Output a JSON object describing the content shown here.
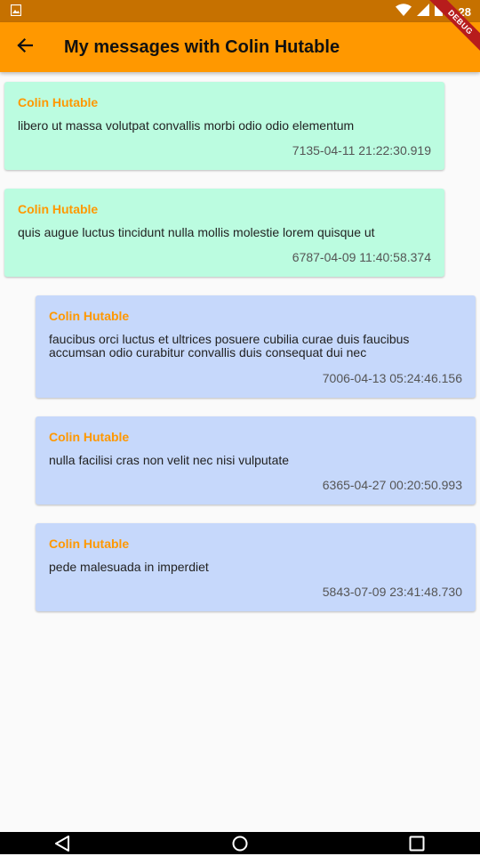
{
  "status_bar": {
    "time": "4:28"
  },
  "app_bar": {
    "title": "My messages with Colin Hutable",
    "debug_label": "DEBUG"
  },
  "messages": [
    {
      "author": "Colin Hutable",
      "text": "libero ut massa volutpat convallis morbi odio odio elementum",
      "timestamp": "7135-04-11 21:22:30.919"
    },
    {
      "author": "Colin Hutable",
      "text": "quis augue luctus tincidunt nulla mollis molestie lorem quisque ut",
      "timestamp": "6787-04-09 11:40:58.374"
    },
    {
      "author": "Colin Hutable",
      "text": "faucibus orci luctus et ultrices posuere cubilia curae duis faucibus accumsan odio curabitur convallis duis consequat dui nec",
      "timestamp": "7006-04-13 05:24:46.156"
    },
    {
      "author": "Colin Hutable",
      "text": "nulla facilisi cras non velit nec nisi vulputate",
      "timestamp": "6365-04-27 00:20:50.993"
    },
    {
      "author": "Colin Hutable",
      "text": "pede malesuada in imperdiet",
      "timestamp": "5843-07-09 23:41:48.730"
    }
  ],
  "colors": {
    "app_bar": "#ff9800",
    "status_bar": "#c67100",
    "author": "#ff9800",
    "bubble_green": "#bbfce0",
    "bubble_blue": "#c6d8fb"
  },
  "icons": {
    "status_left": "image-notification-icon",
    "status_right": [
      "wifi-icon",
      "signal-icon",
      "battery-icon"
    ],
    "app_bar_left": "arrow-back-icon",
    "nav": [
      "nav-back-icon",
      "nav-home-icon",
      "nav-recents-icon"
    ]
  }
}
